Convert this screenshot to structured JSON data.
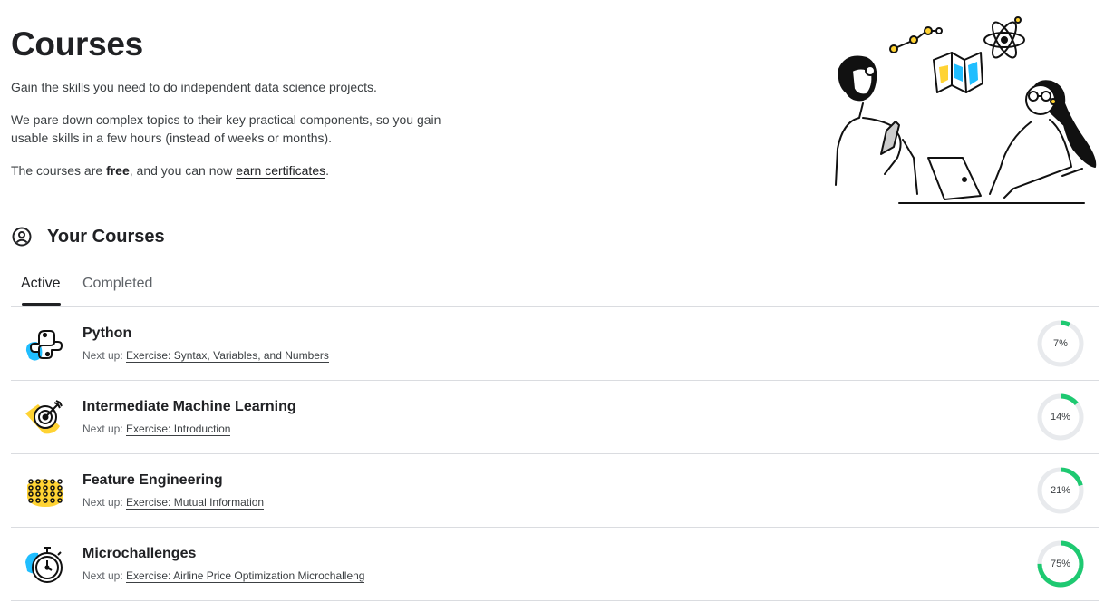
{
  "header": {
    "title": "Courses",
    "intro1": "Gain the skills you need to do independent data science projects.",
    "intro2": "We pare down complex topics to their key practical components, so you gain usable skills in a few hours (instead of weeks or months).",
    "intro3_pre": "The courses are ",
    "intro3_bold": "free",
    "intro3_mid": ", and you can now ",
    "intro3_link": "earn certificates",
    "intro3_post": "."
  },
  "section": {
    "title": "Your Courses",
    "icon": "account-circle-icon"
  },
  "tabs": [
    {
      "label": "Active",
      "active": true
    },
    {
      "label": "Completed",
      "active": false
    }
  ],
  "next_up_label": "Next up:",
  "colors": {
    "progress": "#1ec971",
    "track": "#e8eaed",
    "blue": "#20beff",
    "yellow": "#ffd333"
  },
  "courses": [
    {
      "name": "Python",
      "next": "Exercise: Syntax, Variables, and Numbers",
      "progress": 7,
      "progress_label": "7%",
      "icon": "python-logo-icon"
    },
    {
      "name": "Intermediate Machine Learning",
      "next": "Exercise: Introduction",
      "progress": 14,
      "progress_label": "14%",
      "icon": "target-icon"
    },
    {
      "name": "Feature Engineering",
      "next": "Exercise: Mutual Information",
      "progress": 21,
      "progress_label": "21%",
      "icon": "dot-grid-icon"
    },
    {
      "name": "Microchallenges",
      "next": "Exercise: Airline Price Optimization Microchalleng",
      "progress": 75,
      "progress_label": "75%",
      "icon": "stopwatch-icon"
    }
  ]
}
